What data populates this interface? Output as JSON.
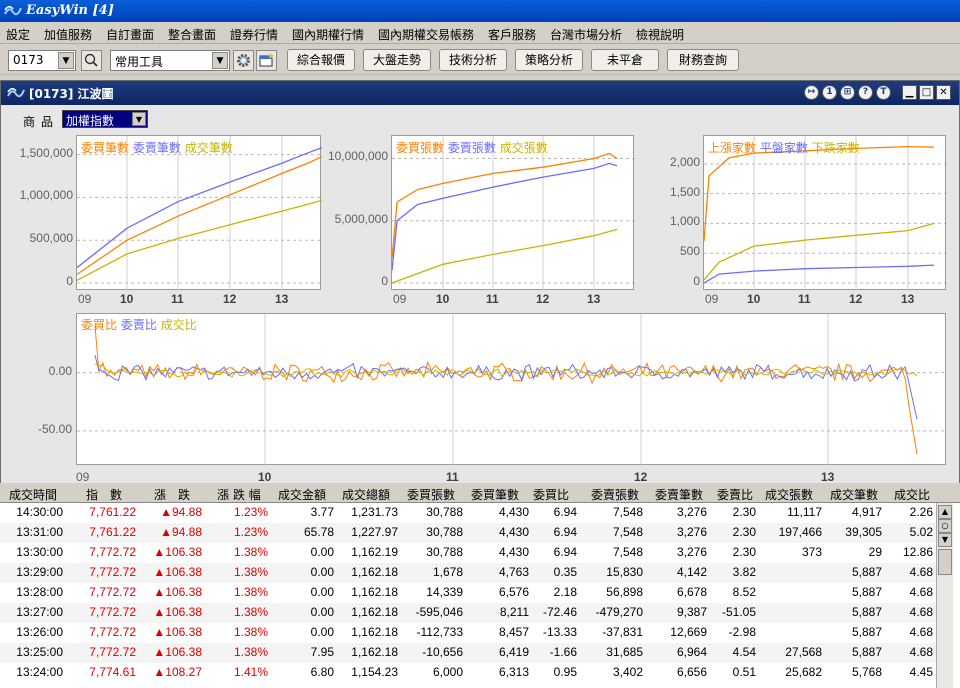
{
  "app": {
    "title": "EasyWin  [4]"
  },
  "menu": [
    "設定",
    "加值服務",
    "自訂畫面",
    "整合畫面",
    "證券行情",
    "國內期權行情",
    "國內期權交易帳務",
    "客戶服務",
    "台灣市場分析",
    "檢視說明"
  ],
  "toolbar": {
    "code": "0173",
    "tools": "常用工具",
    "buttons": [
      "綜合報價",
      "大盤走勢",
      "技術分析",
      "策略分析",
      "未平倉",
      "財務查詢"
    ]
  },
  "window": {
    "title": "[0173] 江波圖",
    "title_buttons": [
      "1",
      "?",
      "T"
    ],
    "product_label": "商品",
    "product_value": "加權指數"
  },
  "chart_data": [
    {
      "type": "line",
      "series": [
        {
          "name": "委買筆數",
          "color": "#ff8000"
        },
        {
          "name": "委賣筆數",
          "color": "#6b6bff"
        },
        {
          "name": "成交筆數",
          "color": "#c8b400"
        }
      ],
      "x_ticks": [
        "09",
        "10",
        "11",
        "12",
        "13"
      ],
      "y_ticks": [
        "1,500,000",
        "1,000,000",
        "500,000",
        "0"
      ],
      "ylim": [
        0,
        1600000
      ],
      "data": [
        [
          [
            0,
            100000
          ],
          [
            1,
            500000
          ],
          [
            2,
            780000
          ],
          [
            3,
            1030000
          ],
          [
            4,
            1280000
          ],
          [
            4.5,
            1400000
          ],
          [
            4.85,
            1500000
          ]
        ],
        [
          [
            0,
            180000
          ],
          [
            1,
            640000
          ],
          [
            2,
            950000
          ],
          [
            3,
            1180000
          ],
          [
            4,
            1400000
          ],
          [
            4.5,
            1520000
          ],
          [
            4.85,
            1600000
          ]
        ],
        [
          [
            0,
            30000
          ],
          [
            1,
            340000
          ],
          [
            2,
            520000
          ],
          [
            3,
            680000
          ],
          [
            4,
            840000
          ],
          [
            4.5,
            920000
          ],
          [
            4.85,
            980000
          ]
        ]
      ]
    },
    {
      "type": "line",
      "series": [
        {
          "name": "委買張數",
          "color": "#ff8000"
        },
        {
          "name": "委賣張數",
          "color": "#6b6bff"
        },
        {
          "name": "成交張數",
          "color": "#c8b400"
        }
      ],
      "x_ticks": [
        "09",
        "10",
        "11",
        "12",
        "13"
      ],
      "y_ticks": [
        "10,000,000",
        "5,000,000",
        "0"
      ],
      "ylim": [
        0,
        11000000
      ],
      "data": [
        [
          [
            0,
            2000000
          ],
          [
            0.1,
            6500000
          ],
          [
            0.5,
            7500000
          ],
          [
            1,
            8000000
          ],
          [
            2,
            8800000
          ],
          [
            3,
            9300000
          ],
          [
            4,
            10000000
          ],
          [
            4.3,
            10400000
          ],
          [
            4.45,
            10000000
          ]
        ],
        [
          [
            0,
            1000000
          ],
          [
            0.1,
            5000000
          ],
          [
            0.5,
            6300000
          ],
          [
            1,
            6800000
          ],
          [
            2,
            7700000
          ],
          [
            3,
            8500000
          ],
          [
            4,
            9200000
          ],
          [
            4.3,
            9600000
          ],
          [
            4.45,
            9400000
          ]
        ],
        [
          [
            0,
            0
          ],
          [
            1,
            1500000
          ],
          [
            2,
            2300000
          ],
          [
            3,
            3000000
          ],
          [
            4,
            3800000
          ],
          [
            4.45,
            4300000
          ]
        ]
      ]
    },
    {
      "type": "line",
      "series": [
        {
          "name": "上漲家數",
          "color": "#ff8000"
        },
        {
          "name": "平盤家數",
          "color": "#6b6bff"
        },
        {
          "name": "下跌家數",
          "color": "#c8b400"
        }
      ],
      "x_ticks": [
        "09",
        "10",
        "11",
        "12",
        "13"
      ],
      "y_ticks": [
        "2,000",
        "1,500",
        "1,000",
        "500",
        "0"
      ],
      "ylim": [
        0,
        2300
      ],
      "data": [
        [
          [
            0,
            700
          ],
          [
            0.1,
            1800
          ],
          [
            0.5,
            2100
          ],
          [
            1,
            2180
          ],
          [
            2,
            2220
          ],
          [
            3,
            2260
          ],
          [
            4,
            2290
          ],
          [
            4.5,
            2280
          ]
        ],
        [
          [
            0,
            0
          ],
          [
            0.3,
            150
          ],
          [
            1,
            200
          ],
          [
            2,
            240
          ],
          [
            3,
            260
          ],
          [
            4,
            280
          ],
          [
            4.5,
            300
          ]
        ],
        [
          [
            0,
            50
          ],
          [
            0.3,
            350
          ],
          [
            1,
            620
          ],
          [
            2,
            720
          ],
          [
            3,
            800
          ],
          [
            4,
            880
          ],
          [
            4.5,
            1000
          ]
        ]
      ]
    },
    {
      "type": "line",
      "series": [
        {
          "name": "委買比",
          "color": "#ff8000"
        },
        {
          "name": "委賣比",
          "color": "#6b6bff"
        },
        {
          "name": "成交比",
          "color": "#c8b400"
        }
      ],
      "x_ticks": [
        "09",
        "10",
        "11",
        "12",
        "13"
      ],
      "y_ticks": [
        "0.00",
        "-50.00"
      ],
      "ylim": [
        -75,
        40
      ],
      "spike": {
        "x_start": 0.05,
        "y_start": 40,
        "x_end": 4.5,
        "y_end": -70
      }
    }
  ],
  "table": {
    "headers": [
      "成交時間",
      "指　數",
      "漲　跌",
      "漲 跌 幅",
      "成交金額",
      "成交總額",
      "委買張數",
      "委買筆數",
      "委買比",
      "委賣張數",
      "委賣筆數",
      "委賣比",
      "成交張數",
      "成交筆數",
      "成交比"
    ],
    "rows": [
      [
        "14:30:00",
        "7,761.22",
        "▲94.88",
        "1.23%",
        "3.77",
        "1,231.73",
        "30,788",
        "4,430",
        "6.94",
        "7,548",
        "3,276",
        "2.30",
        "11,117",
        "4,917",
        "2.26"
      ],
      [
        "13:31:00",
        "7,761.22",
        "▲94.88",
        "1.23%",
        "65.78",
        "1,227.97",
        "30,788",
        "4,430",
        "6.94",
        "7,548",
        "3,276",
        "2.30",
        "197,466",
        "39,305",
        "5.02"
      ],
      [
        "13:30:00",
        "7,772.72",
        "▲106.38",
        "1.38%",
        "0.00",
        "1,162.19",
        "30,788",
        "4,430",
        "6.94",
        "7,548",
        "3,276",
        "2.30",
        "373",
        "29",
        "12.86"
      ],
      [
        "13:29:00",
        "7,772.72",
        "▲106.38",
        "1.38%",
        "0.00",
        "1,162.18",
        "1,678",
        "4,763",
        "0.35",
        "15,830",
        "4,142",
        "3.82",
        "",
        "5,887",
        "4.68"
      ],
      [
        "13:28:00",
        "7,772.72",
        "▲106.38",
        "1.38%",
        "0.00",
        "1,162.18",
        "14,339",
        "6,576",
        "2.18",
        "56,898",
        "6,678",
        "8.52",
        "",
        "5,887",
        "4.68"
      ],
      [
        "13:27:00",
        "7,772.72",
        "▲106.38",
        "1.38%",
        "0.00",
        "1,162.18",
        "-595,046",
        "8,211",
        "-72.46",
        "-479,270",
        "9,387",
        "-51.05",
        "",
        "5,887",
        "4.68"
      ],
      [
        "13:26:00",
        "7,772.72",
        "▲106.38",
        "1.38%",
        "0.00",
        "1,162.18",
        "-112,733",
        "8,457",
        "-13.33",
        "-37,831",
        "12,669",
        "-2.98",
        "",
        "5,887",
        "4.68"
      ],
      [
        "13:25:00",
        "7,772.72",
        "▲106.38",
        "1.38%",
        "7.95",
        "1,162.18",
        "-10,656",
        "6,419",
        "-1.66",
        "31,685",
        "6,964",
        "4.54",
        "27,568",
        "5,887",
        "4.68"
      ],
      [
        "13:24:00",
        "7,774.61",
        "▲108.27",
        "1.41%",
        "6.80",
        "1,154.23",
        "6,000",
        "6,313",
        "0.95",
        "3,402",
        "6,656",
        "0.51",
        "25,682",
        "5,768",
        "4.45"
      ]
    ]
  }
}
